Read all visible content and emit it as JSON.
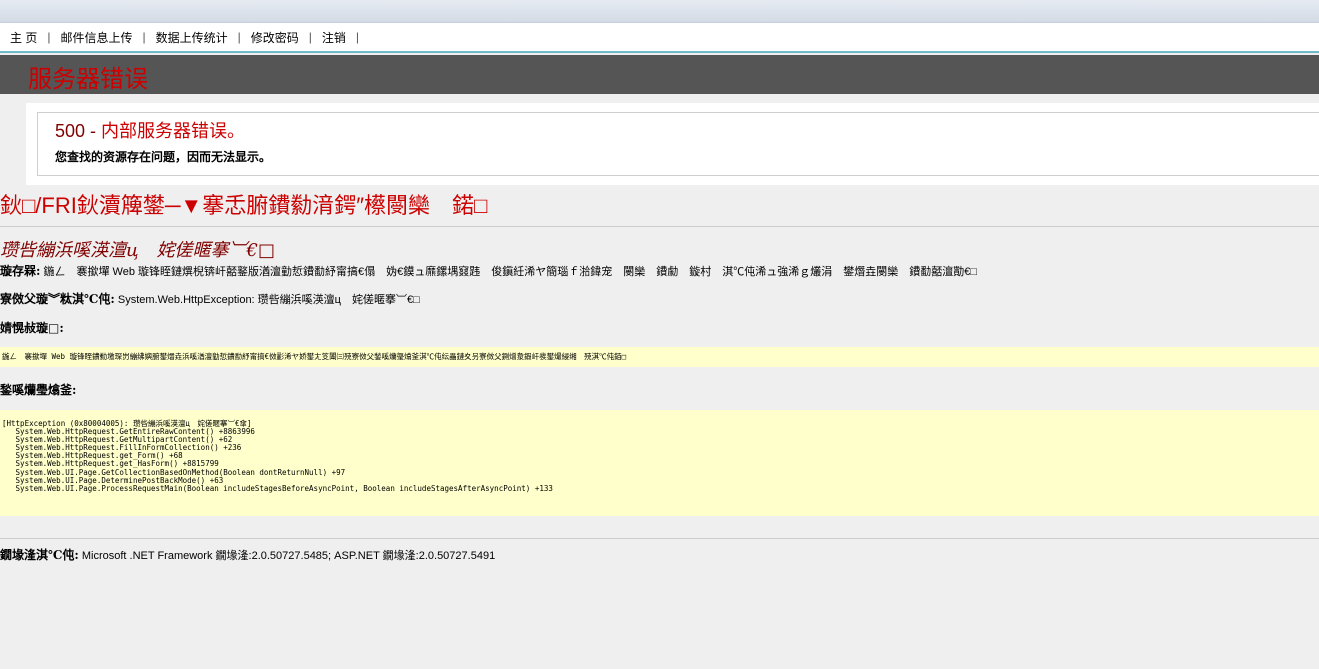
{
  "nav": {
    "items": [
      "主 页",
      "邮件信息上传",
      "数据上传统计",
      "修改密码",
      "注销"
    ],
    "separator": "|"
  },
  "header": {
    "title": "服务器错误"
  },
  "error_panel": {
    "code": "500 -",
    "code_text": "内部服务器错误。",
    "message": "您查找的资源存在问题，因而无法显示。"
  },
  "aspnet": {
    "title": "鈥□/FRI鈥瀆簰鐢─▼搴忎腑鐨勬湇鍔″櫒閿欒　鍩□",
    "subtitle": "瓒呰繃浜嗘渶澶ц　姹傞暱搴︺€□",
    "description_label": "璇存槑:",
    "description_text": "鍦ㄥ　褰撳墠 Web 璇锋眰鏈熼棿锛屽嚭鐜版湭澶勭悊鐨勫紓甯搞€傝　妫€鏌ュ爢鏍堣窡韪　俊鎭紝浠ヤ簡瑙ｆ湁鍏宠　閿欒　鐨勮　鏇村　淇℃伅浠ュ強浠ｇ爜涓　鐢熸垚閿欒　鐨勫嚭澶勩€□",
    "exception_label": "寮傚父璇︾粏淇℃伅:",
    "exception_text": "System.Web.HttpException: 瓒呰繃浜嗘渶澶ц　姹傞暱搴︺€□",
    "source_error_label": "婧愰敊璇□:",
    "source_error_text": "鍦ㄥ　褰撳墠 Web 璇锋眰鐨勬墽琛岃繃绋嬩腑鐢熸垚浜嗘湭澶勭悊鐨勫紓甯搞€傚彲浠ヤ娇鐢ㄤ笅闈㈢殑寮傚父鍫嗘爤璺熻釜淇℃伅纭畾鏈夊叧寮傚父鍘熷洜鍜屽彂鐢熶綅缃　殑淇℃伅銆□",
    "stack_label": "鍫嗘爤璺熻釜:",
    "stack_trace": [
      "[HttpException (0x80004005): 瓒呰繃浜嗘渶澶ц　姹傞暱搴︺€傘]",
      "   System.Web.HttpRequest.GetEntireRawContent() +8863996",
      "   System.Web.HttpRequest.GetMultipartContent() +62",
      "   System.Web.HttpRequest.FillInFormCollection() +236",
      "   System.Web.HttpRequest.get_Form() +68",
      "   System.Web.HttpRequest.get_HasForm() +8815799",
      "   System.Web.UI.Page.GetCollectionBasedOnMethod(Boolean dontReturnNull) +97",
      "   System.Web.UI.Page.DeterminePostBackMode() +63",
      "   System.Web.UI.Page.ProcessRequestMain(Boolean includeStagesBeforeAsyncPoint, Boolean includeStagesAfterAsyncPoint) +133"
    ],
    "version_label": "鐗堟湰淇℃伅:",
    "version_text": "Microsoft .NET Framework 鐗堟湰:2.0.50727.5485; ASP.NET 鐗堟湰:2.0.50727.5491"
  }
}
